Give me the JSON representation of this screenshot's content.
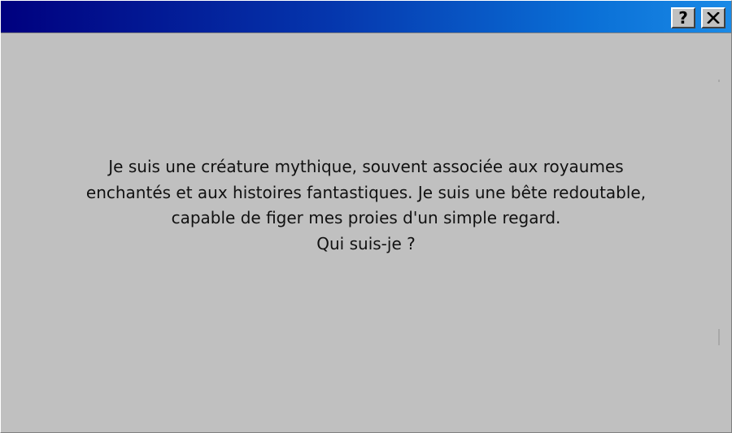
{
  "titlebar": {
    "help_button": {
      "label": "?",
      "icon": "help-icon"
    },
    "close_button": {
      "icon": "close-icon"
    }
  },
  "riddle": {
    "lines": [
      "Je suis une créature mythique, souvent associée aux royaumes",
      "enchantés et aux histoires fantastiques. Je suis une bête redoutable,",
      "capable de figer mes proies d'un simple regard.",
      "Qui suis-je ?"
    ]
  },
  "colors": {
    "titlebar_start": "#00007f",
    "titlebar_end": "#1a8ae6",
    "window_background": "#c0c0c0",
    "text": "#111111"
  }
}
